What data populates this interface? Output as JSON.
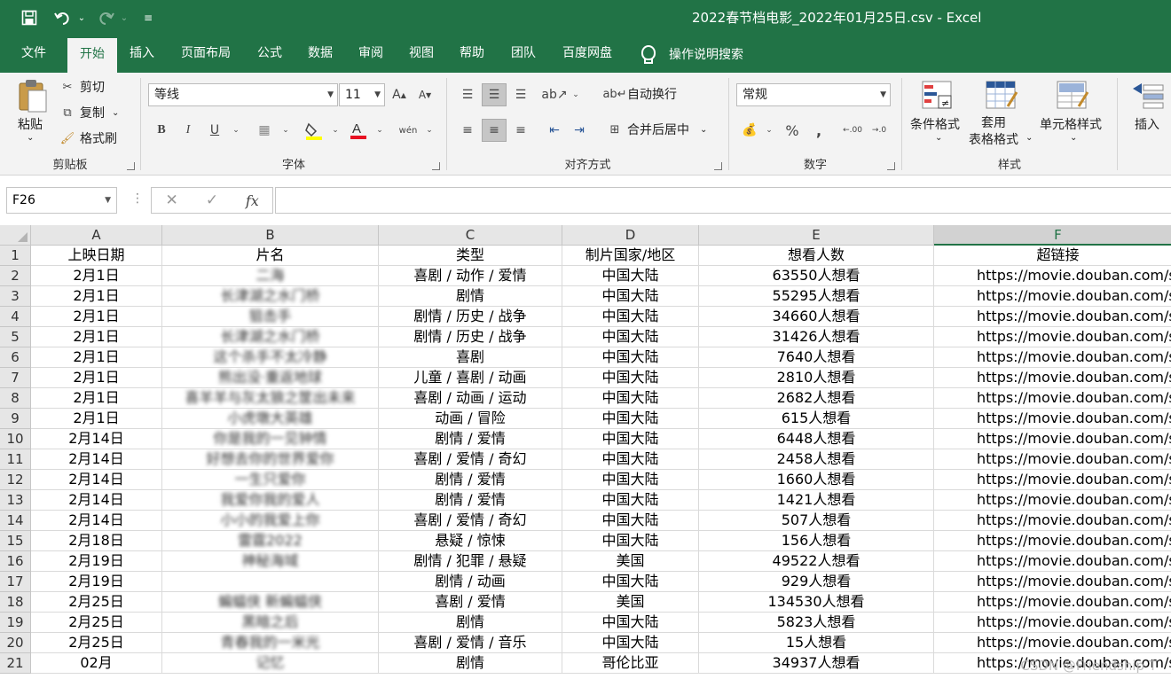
{
  "window": {
    "title": "2022春节档电影_2022年01月25日.csv  -  Excel"
  },
  "qat": {
    "save_icon": "save-icon",
    "undo_icon": "undo-icon",
    "redo_icon": "redo-icon",
    "customize_icon": "customize-qat-icon"
  },
  "tabs": [
    "文件",
    "开始",
    "插入",
    "页面布局",
    "公式",
    "数据",
    "审阅",
    "视图",
    "帮助",
    "团队",
    "百度网盘"
  ],
  "tell_me": "操作说明搜索",
  "ribbon": {
    "clipboard": {
      "paste": "粘贴",
      "cut": "剪切",
      "copy": "复制",
      "format_painter": "格式刷",
      "label": "剪贴板"
    },
    "font": {
      "name": "等线",
      "size": "11",
      "bold": "B",
      "italic": "I",
      "underline": "U",
      "label": "字体",
      "phonetic": "wén",
      "grow": "A",
      "shrink": "A"
    },
    "alignment": {
      "wrap": "自动换行",
      "merge": "合并后居中",
      "label": "对齐方式"
    },
    "number": {
      "format": "常规",
      "percent": "%",
      "comma": ",",
      "inc_dec": ".00",
      "dec_dec": ".0",
      "label": "数字"
    },
    "styles": {
      "conditional": "条件格式",
      "table": "套用\n表格格式",
      "cell": "单元格样式",
      "label": "样式"
    },
    "cells": {
      "insert": "插入"
    }
  },
  "formula_bar": {
    "name_box": "F26",
    "value": "",
    "fx": "fx"
  },
  "sheet": {
    "columns": [
      {
        "letter": "A"
      },
      {
        "letter": "B"
      },
      {
        "letter": "C"
      },
      {
        "letter": "D"
      },
      {
        "letter": "E"
      },
      {
        "letter": "F"
      }
    ],
    "rows": [
      {
        "n": "1",
        "a": "上映日期",
        "b": "片名",
        "c": "类型",
        "d": "制片国家/地区",
        "e": "想看人数",
        "f": "超链接"
      },
      {
        "n": "2",
        "a": "2月1日",
        "b": "二海",
        "c": "喜剧 / 动作 / 爱情",
        "d": "中国大陆",
        "e": "63550人想看",
        "f": "https://movie.douban.com/su"
      },
      {
        "n": "3",
        "a": "2月1日",
        "b": "长津湖之水门桥",
        "c": "剧情",
        "d": "中国大陆",
        "e": "55295人想看",
        "f": "https://movie.douban.com/su"
      },
      {
        "n": "4",
        "a": "2月1日",
        "b": "狙击手",
        "c": "剧情 / 历史 / 战争",
        "d": "中国大陆",
        "e": "34660人想看",
        "f": "https://movie.douban.com/su"
      },
      {
        "n": "5",
        "a": "2月1日",
        "b": "长津湖之水门桥",
        "c": "剧情 / 历史 / 战争",
        "d": "中国大陆",
        "e": "31426人想看",
        "f": "https://movie.douban.com/su"
      },
      {
        "n": "6",
        "a": "2月1日",
        "b": "这个杀手不太冷静",
        "c": "喜剧",
        "d": "中国大陆",
        "e": "7640人想看",
        "f": "https://movie.douban.com/su"
      },
      {
        "n": "7",
        "a": "2月1日",
        "b": "熊出没·重返地球",
        "c": "儿童 / 喜剧 / 动画",
        "d": "中国大陆",
        "e": "2810人想看",
        "f": "https://movie.douban.com/su"
      },
      {
        "n": "8",
        "a": "2月1日",
        "b": "喜羊羊与灰太狼之筐出未来",
        "c": "喜剧 / 动画 / 运动",
        "d": "中国大陆",
        "e": "2682人想看",
        "f": "https://movie.douban.com/su"
      },
      {
        "n": "9",
        "a": "2月1日",
        "b": "小虎墩大英雄",
        "c": "动画 / 冒险",
        "d": "中国大陆",
        "e": "615人想看",
        "f": "https://movie.douban.com/su"
      },
      {
        "n": "10",
        "a": "2月14日",
        "b": "你是我的一见钟情",
        "c": "剧情 / 爱情",
        "d": "中国大陆",
        "e": "6448人想看",
        "f": "https://movie.douban.com/su"
      },
      {
        "n": "11",
        "a": "2月14日",
        "b": "好想去你的世界爱你",
        "c": "喜剧 / 爱情 / 奇幻",
        "d": "中国大陆",
        "e": "2458人想看",
        "f": "https://movie.douban.com/su"
      },
      {
        "n": "12",
        "a": "2月14日",
        "b": "一生只爱你",
        "c": "剧情 / 爱情",
        "d": "中国大陆",
        "e": "1660人想看",
        "f": "https://movie.douban.com/su"
      },
      {
        "n": "13",
        "a": "2月14日",
        "b": "我爱你我的爱人",
        "c": "剧情 / 爱情",
        "d": "中国大陆",
        "e": "1421人想看",
        "f": "https://movie.douban.com/su"
      },
      {
        "n": "14",
        "a": "2月14日",
        "b": "小小的我爱上你",
        "c": "喜剧 / 爱情 / 奇幻",
        "d": "中国大陆",
        "e": "507人想看",
        "f": "https://movie.douban.com/su"
      },
      {
        "n": "15",
        "a": "2月18日",
        "b": "雷霆2022",
        "c": "悬疑 / 惊悚",
        "d": "中国大陆",
        "e": "156人想看",
        "f": "https://movie.douban.com/su"
      },
      {
        "n": "16",
        "a": "2月19日",
        "b": "神秘海域",
        "c": "剧情 / 犯罪 / 悬疑",
        "d": "美国",
        "e": "49522人想看",
        "f": "https://movie.douban.com/su"
      },
      {
        "n": "17",
        "a": "2月19日",
        "b": "",
        "c": "剧情 / 动画",
        "d": "中国大陆",
        "e": "929人想看",
        "f": "https://movie.douban.com/su"
      },
      {
        "n": "18",
        "a": "2月25日",
        "b": "蝙蝠侠 新蝙蝠侠",
        "c": "喜剧 / 爱情",
        "d": "美国",
        "e": "134530人想看",
        "f": "https://movie.douban.com/su"
      },
      {
        "n": "19",
        "a": "2月25日",
        "b": "黑暗之后",
        "c": "剧情",
        "d": "中国大陆",
        "e": "5823人想看",
        "f": "https://movie.douban.com/su"
      },
      {
        "n": "20",
        "a": "2月25日",
        "b": "青春我的一米光",
        "c": "喜剧 / 爱情 / 音乐",
        "d": "中国大陆",
        "e": "15人想看",
        "f": "https://movie.douban.com/su"
      },
      {
        "n": "21",
        "a": "02月",
        "b": "记忆",
        "c": "剧情",
        "d": "哥伦比亚",
        "e": "34937人想看",
        "f": "https://movie.douban.com/su"
      }
    ]
  },
  "watermark": "CSDN @Friendship T"
}
